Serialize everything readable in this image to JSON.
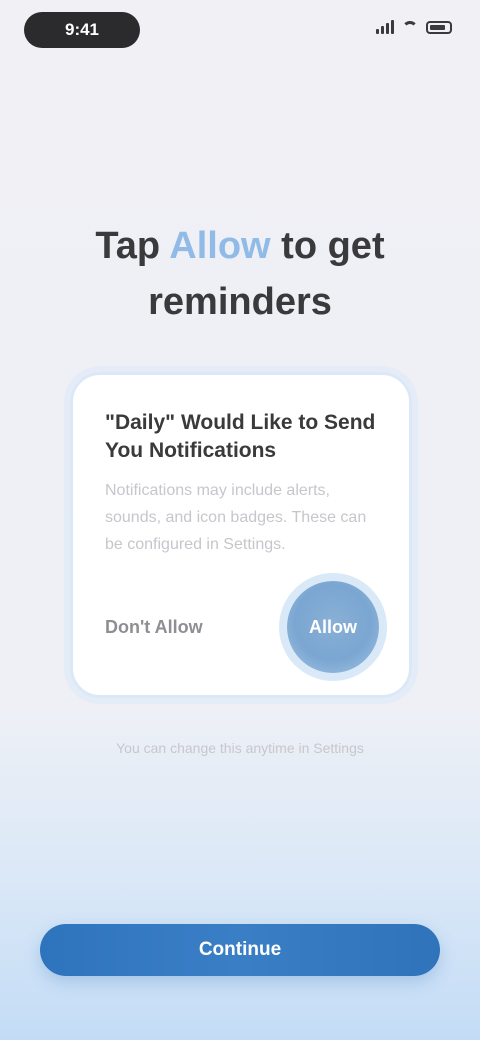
{
  "status_bar": {
    "time": "9:41",
    "icons": [
      "signal-icon",
      "wifi-icon",
      "battery-icon"
    ]
  },
  "headline": {
    "prefix": "Tap",
    "accent": "Allow",
    "suffix": "to get",
    "line2": "reminders"
  },
  "card": {
    "title": "\"Daily\" Would Like to Send You Notifications",
    "body": "Notifications may include alerts, sounds, and icon badges. These can be configured in Settings.",
    "secondary_label": "Don't Allow",
    "primary_label": "Allow"
  },
  "hint": "You can change this anytime in Settings",
  "cta": {
    "label": "Continue"
  },
  "colors": {
    "accent": "#8fbbe6",
    "primary": "#2e74bd"
  }
}
